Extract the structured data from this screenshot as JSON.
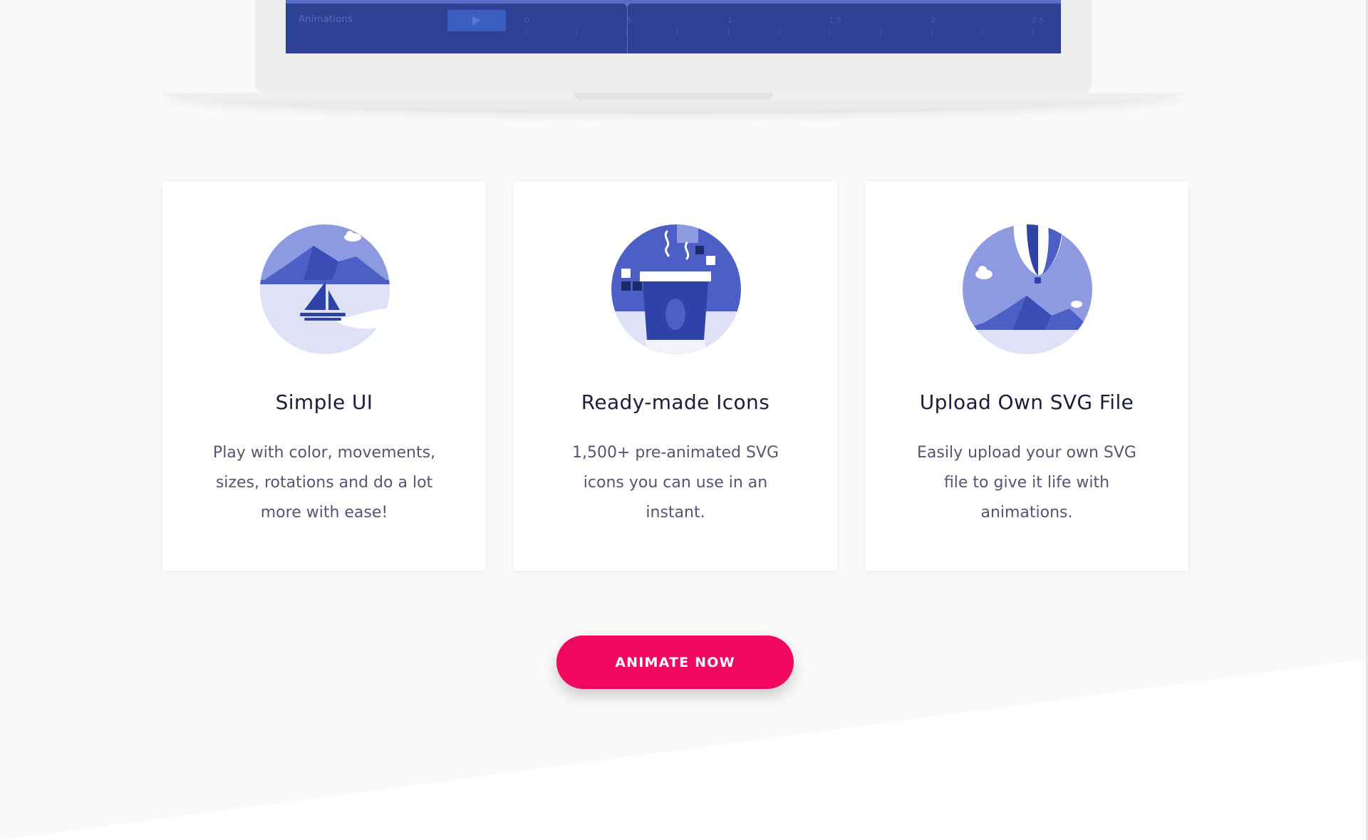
{
  "colors": {
    "background": "#f9f9f9",
    "screen": "#2e4192",
    "icon_primary": "#4b5fc4",
    "icon_light": "#dfe2f6",
    "cta": "#f0075f",
    "title": "#1c1d3a",
    "body_text": "#555572"
  },
  "laptop": {
    "screen_label": "Animations",
    "ruler_numbers": [
      "0",
      ".5",
      "1",
      "1.5",
      "2",
      "2.5"
    ]
  },
  "features": [
    {
      "icon": "sailboat-landscape-icon",
      "title": "Simple UI",
      "description": "Play with color, movements, sizes, rotations and do a lot more with ease!"
    },
    {
      "icon": "coffee-cup-icon",
      "title": "Ready-made Icons",
      "description": "1,500+ pre-animated SVG icons you can use in an instant."
    },
    {
      "icon": "hot-air-balloon-icon",
      "title": "Upload Own SVG File",
      "description": "Easily upload your own SVG file to give it life with animations."
    }
  ],
  "cta": {
    "label": "ANIMATE NOW"
  }
}
